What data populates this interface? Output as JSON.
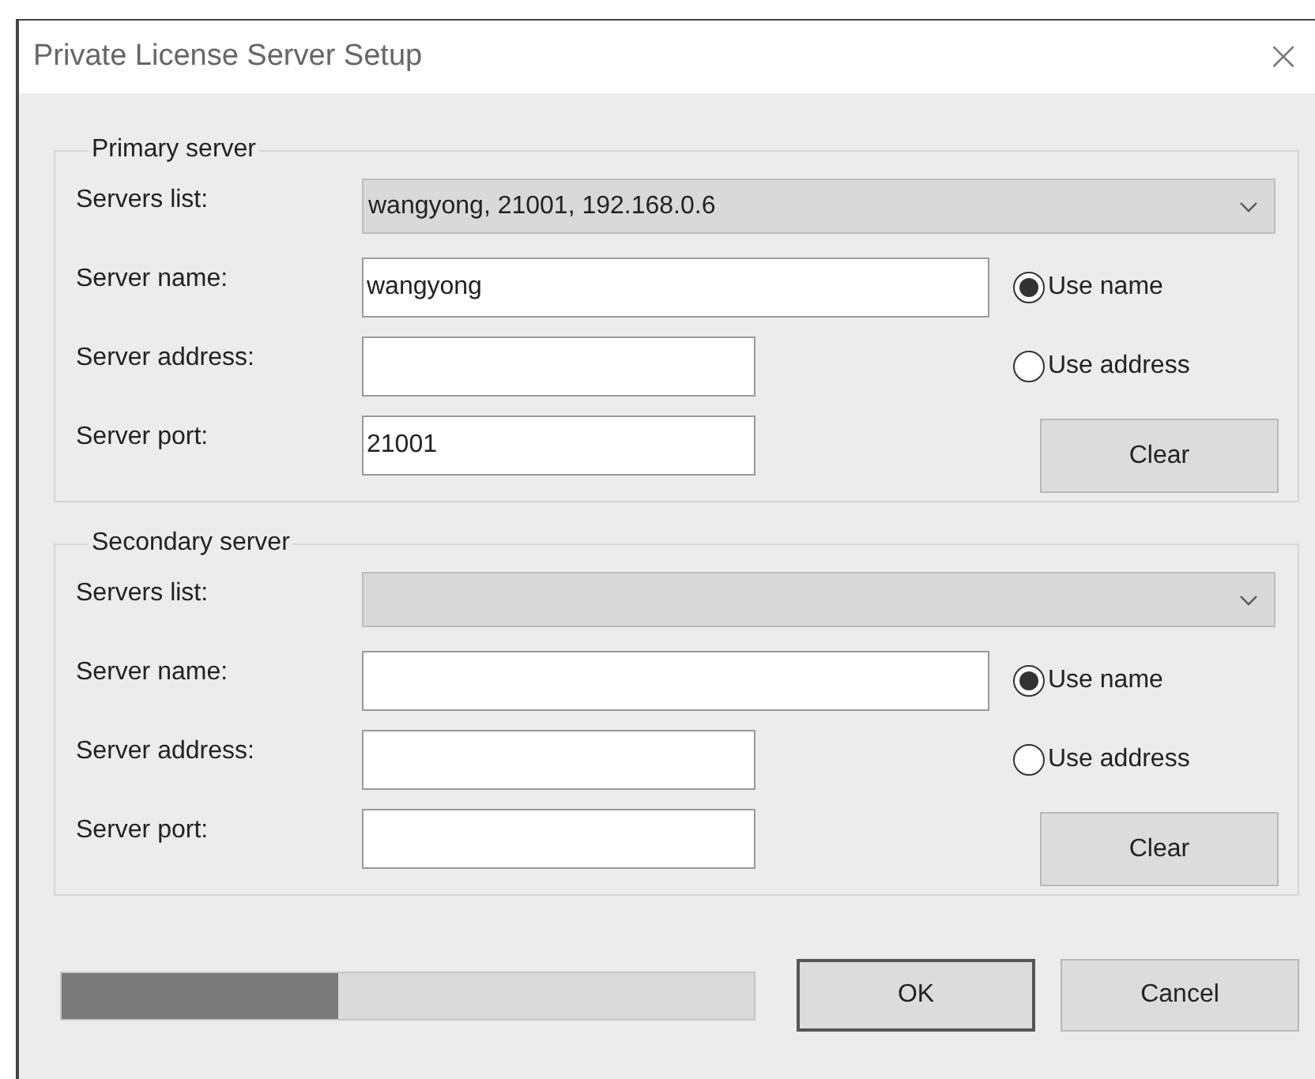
{
  "window": {
    "title": "Private License Server Setup",
    "close": "×"
  },
  "groups": [
    {
      "title": "Primary server",
      "fields": [
        {
          "kind": "combo",
          "label": "Servers list:",
          "value": "wangyong, 21001, 192.168.0.6"
        },
        {
          "kind": "wide",
          "label": "Server name:",
          "value": "wangyong"
        },
        {
          "kind": "narrow",
          "label": "Server address:"
        },
        {
          "kind": "narrow",
          "label": "Server port:",
          "value": "21001"
        }
      ],
      "options": [
        {
          "label": "Use name",
          "selected": true
        },
        {
          "label": "Use address",
          "selected": false
        }
      ],
      "clear_button": "Clear"
    },
    {
      "title": "Secondary server",
      "fields": [
        {
          "kind": "combo",
          "label": "Servers list:"
        },
        {
          "kind": "wide",
          "label": "Server name:"
        },
        {
          "kind": "narrow",
          "label": "Server address:"
        },
        {
          "kind": "narrow",
          "label": "Server port:"
        }
      ],
      "options": [
        {
          "label": "Use name",
          "selected": true
        },
        {
          "label": "Use address",
          "selected": false
        }
      ],
      "clear_button": "Clear"
    }
  ],
  "progress": {
    "level": 0.4
  },
  "buttons": [
    {
      "label": "OK",
      "default": true
    },
    {
      "label": "Cancel",
      "default": false
    }
  ]
}
